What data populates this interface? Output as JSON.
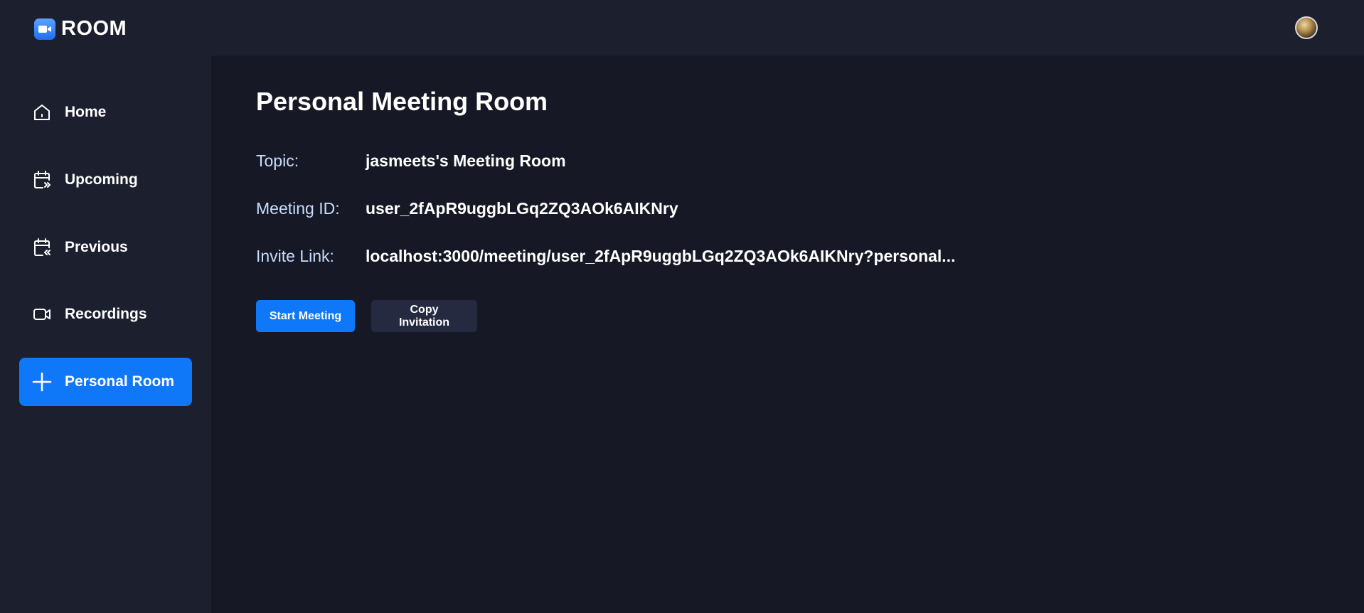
{
  "brand": {
    "name": "ROOM"
  },
  "sidebar": {
    "items": [
      {
        "label": "Home",
        "icon": "home-icon",
        "active": false
      },
      {
        "label": "Upcoming",
        "icon": "calendar-forward-icon",
        "active": false
      },
      {
        "label": "Previous",
        "icon": "calendar-back-icon",
        "active": false
      },
      {
        "label": "Recordings",
        "icon": "video-icon",
        "active": false
      },
      {
        "label": "Personal Room",
        "icon": "plus-icon",
        "active": true
      }
    ]
  },
  "main": {
    "title": "Personal Meeting Room",
    "topic_label": "Topic:",
    "topic_value": "jasmeets's Meeting Room",
    "meeting_id_label": "Meeting ID:",
    "meeting_id_value": "user_2fApR9uggbLGq2ZQ3AOk6AIKNry",
    "invite_label": "Invite Link:",
    "invite_value": "localhost:3000/meeting/user_2fApR9uggbLGq2ZQ3AOk6AIKNry?personal...",
    "start_button": "Start Meeting",
    "copy_button": "Copy Invitation"
  },
  "colors": {
    "accent": "#0e78f9",
    "sidebar_bg": "#1c1f2e",
    "main_bg": "#161925",
    "label_text": "#c9ddff",
    "secondary_button": "#252a41"
  }
}
